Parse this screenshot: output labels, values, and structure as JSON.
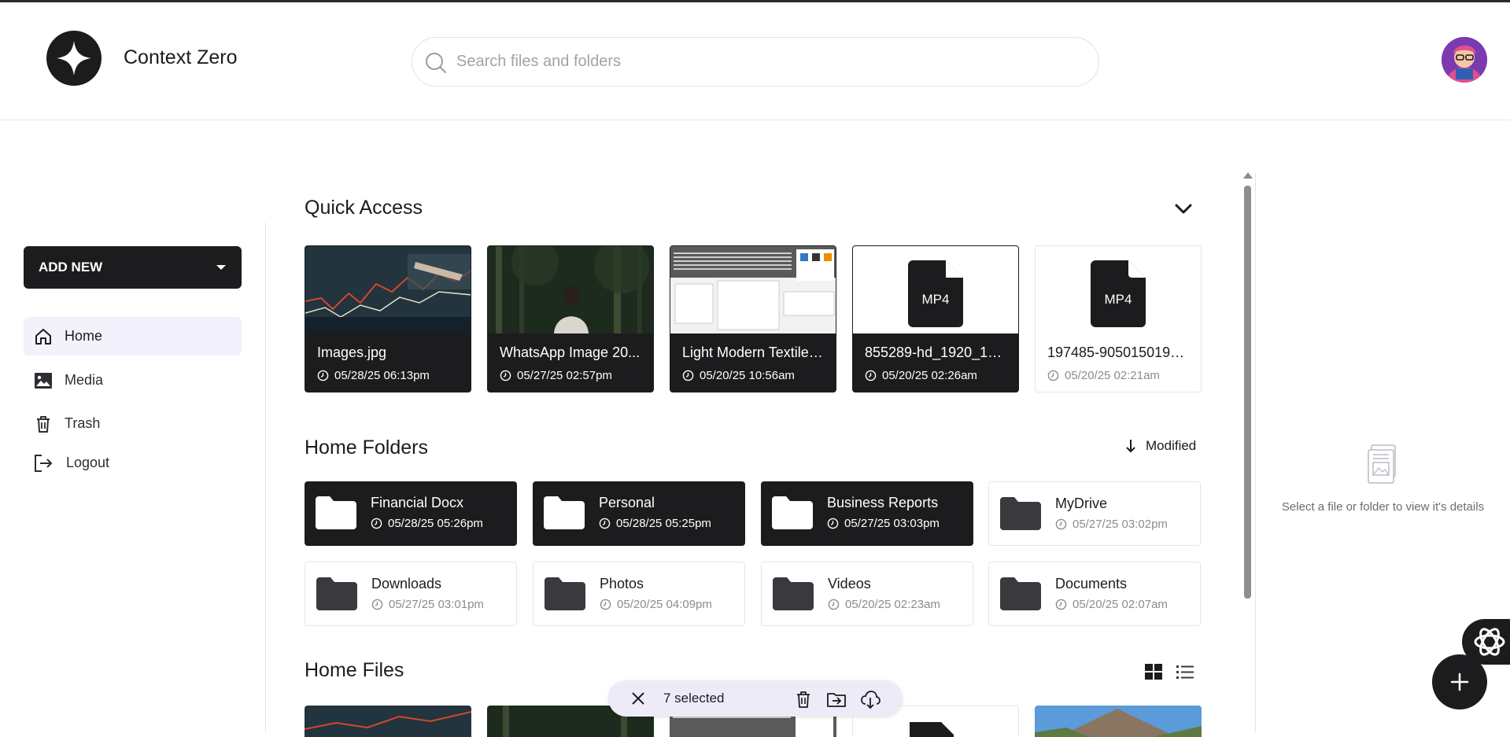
{
  "app": {
    "name": "Context Zero"
  },
  "search": {
    "placeholder": "Search files and folders",
    "value": ""
  },
  "sidebar": {
    "add_new_label": "ADD NEW",
    "items": [
      {
        "label": "Home",
        "icon": "home-icon",
        "active": true
      },
      {
        "label": "Media",
        "icon": "image-icon",
        "active": false
      },
      {
        "label": "Trash",
        "icon": "trash-icon",
        "active": false
      },
      {
        "label": "Logout",
        "icon": "logout-icon",
        "active": false
      }
    ]
  },
  "quick_access": {
    "title": "Quick Access",
    "items": [
      {
        "name": "Images.jpg",
        "date": "05/28/25 06:13pm",
        "thumb": "stock-chart-photo",
        "style": "dark"
      },
      {
        "name": "WhatsApp Image 20...",
        "date": "05/27/25 02:57pm",
        "thumb": "person-in-forest-photo",
        "style": "dark"
      },
      {
        "name": "Light Modern Textile ...",
        "date": "05/20/25 10:56am",
        "thumb": "document-screenshot",
        "style": "dark"
      },
      {
        "name": "855289-hd_1920_10...",
        "date": "05/20/25 02:26am",
        "thumb": "mp4-file-icon",
        "style": "dark",
        "badge": "MP4"
      },
      {
        "name": "197485-905015019_...",
        "date": "05/20/25 02:21am",
        "thumb": "mp4-file-icon",
        "style": "light",
        "badge": "MP4"
      }
    ]
  },
  "home_folders": {
    "title": "Home Folders",
    "sort_label": "Modified",
    "items": [
      {
        "name": "Financial Docx",
        "date": "05/28/25 05:26pm",
        "style": "dark"
      },
      {
        "name": "Personal",
        "date": "05/28/25 05:25pm",
        "style": "dark"
      },
      {
        "name": "Business Reports",
        "date": "05/27/25 03:03pm",
        "style": "dark"
      },
      {
        "name": "MyDrive",
        "date": "05/27/25 03:02pm",
        "style": "light"
      },
      {
        "name": "Downloads",
        "date": "05/27/25 03:01pm",
        "style": "light"
      },
      {
        "name": "Photos",
        "date": "05/20/25 04:09pm",
        "style": "light"
      },
      {
        "name": "Videos",
        "date": "05/20/25 02:23am",
        "style": "light"
      },
      {
        "name": "Documents",
        "date": "05/20/25 02:07am",
        "style": "light"
      }
    ]
  },
  "home_files": {
    "title": "Home Files"
  },
  "selection": {
    "count_label": "7 selected"
  },
  "details": {
    "empty_text": "Select a file or folder to view it's details"
  },
  "colors": {
    "primary": "#1c1c1f",
    "accent_bg": "#f3f1fb",
    "selection_bg": "#eeebf9",
    "muted": "#8b8b92"
  }
}
